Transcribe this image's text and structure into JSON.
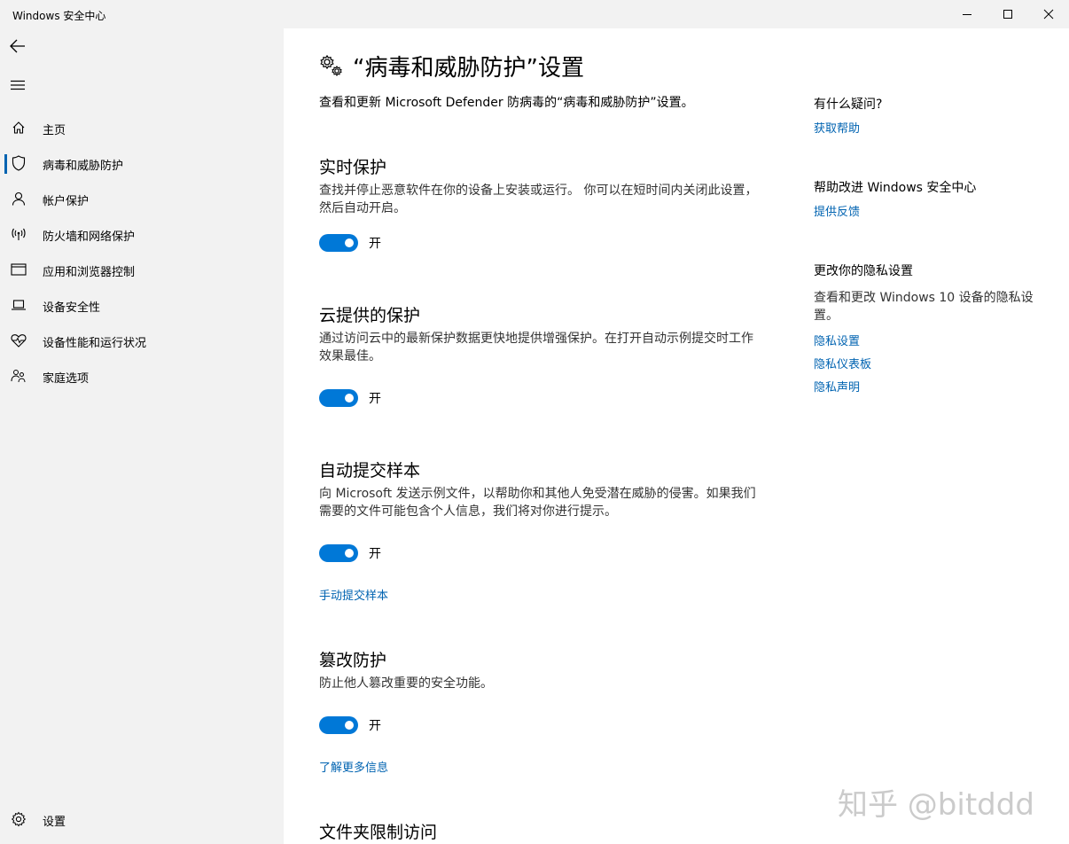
{
  "window": {
    "title": "Windows 安全中心"
  },
  "sidebar": {
    "items": [
      {
        "label": "主页",
        "icon": "home-icon"
      },
      {
        "label": "病毒和威胁防护",
        "icon": "shield-icon",
        "active": true
      },
      {
        "label": "帐户保护",
        "icon": "person-icon"
      },
      {
        "label": "防火墙和网络保护",
        "icon": "antenna-icon"
      },
      {
        "label": "应用和浏览器控制",
        "icon": "window-icon"
      },
      {
        "label": "设备安全性",
        "icon": "laptop-icon"
      },
      {
        "label": "设备性能和运行状况",
        "icon": "heart-icon"
      },
      {
        "label": "家庭选项",
        "icon": "family-icon"
      }
    ],
    "settings_label": "设置"
  },
  "main": {
    "title": "“病毒和威胁防护”设置",
    "description": "查看和更新 Microsoft Defender 防病毒的“病毒和威胁防护”设置。",
    "sections": [
      {
        "heading": "实时保护",
        "description": "查找并停止恶意软件在你的设备上安装或运行。 你可以在短时间内关闭此设置，然后自动开启。",
        "toggle_label": "开"
      },
      {
        "heading": "云提供的保护",
        "description": "通过访问云中的最新保护数据更快地提供增强保护。在打开自动示例提交时工作效果最佳。",
        "toggle_label": "开"
      },
      {
        "heading": "自动提交样本",
        "description": "向 Microsoft 发送示例文件，以帮助你和其他人免受潜在威胁的侵害。如果我们需要的文件可能包含个人信息，我们将对你进行提示。",
        "toggle_label": "开",
        "link": "手动提交样本"
      },
      {
        "heading": "篡改防护",
        "description": "防止他人篡改重要的安全功能。",
        "toggle_label": "开",
        "link": "了解更多信息"
      },
      {
        "heading": "文件夹限制访问"
      }
    ]
  },
  "right_panel": {
    "question_heading": "有什么疑问?",
    "help_link": "获取帮助",
    "improve_heading": "帮助改进 Windows 安全中心",
    "feedback_link": "提供反馈",
    "privacy_heading": "更改你的隐私设置",
    "privacy_desc": "查看和更改 Windows 10 设备的隐私设置。",
    "privacy_links": [
      "隐私设置",
      "隐私仪表板",
      "隐私声明"
    ]
  },
  "watermark": "知乎 @bitddd",
  "colors": {
    "accent": "#0078d7",
    "link": "#0063b1",
    "sidebar_bg": "#f2f2f2"
  }
}
